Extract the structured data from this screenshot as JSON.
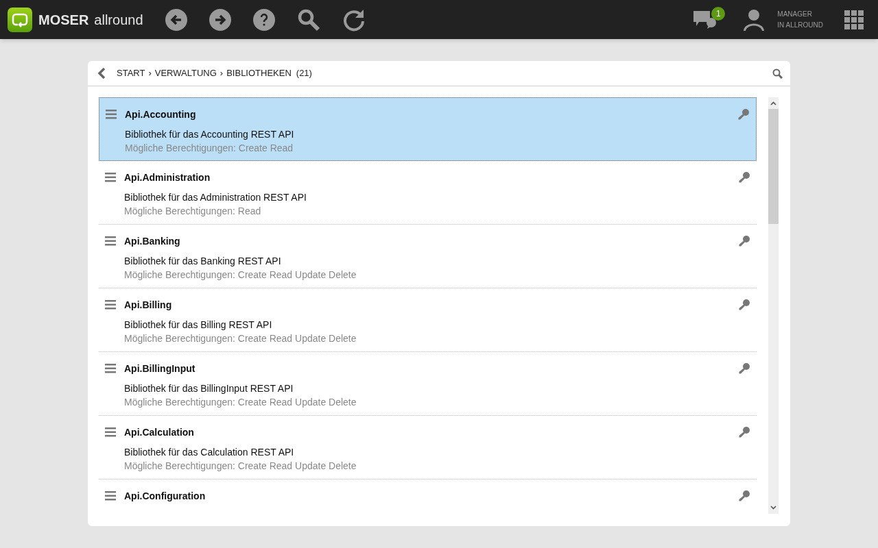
{
  "header": {
    "brand": "MOSER",
    "product": "allround",
    "messages_badge": "1",
    "user_role": "MANAGER",
    "user_scope": "IN ALLROUND"
  },
  "breadcrumb": {
    "items": [
      "START",
      "VERWALTUNG",
      "BIBLIOTHEKEN"
    ],
    "separator": "›",
    "count": "(21)"
  },
  "libraries": [
    {
      "name": "Api.Accounting",
      "description": "Bibliothek für das Accounting REST API",
      "permissions": "Mögliche Berechtigungen: Create Read",
      "selected": true
    },
    {
      "name": "Api.Administration",
      "description": "Bibliothek für das Administration REST API",
      "permissions": "Mögliche Berechtigungen: Read",
      "selected": false
    },
    {
      "name": "Api.Banking",
      "description": "Bibliothek für das Banking REST API",
      "permissions": "Mögliche Berechtigungen: Create Read Update Delete",
      "selected": false
    },
    {
      "name": "Api.Billing",
      "description": "Bibliothek für das Billing REST API",
      "permissions": "Mögliche Berechtigungen: Create Read Update Delete",
      "selected": false
    },
    {
      "name": "Api.BillingInput",
      "description": "Bibliothek für das BillingInput REST API",
      "permissions": "Mögliche Berechtigungen: Create Read Update Delete",
      "selected": false
    },
    {
      "name": "Api.Calculation",
      "description": "Bibliothek für das Calculation REST API",
      "permissions": "Mögliche Berechtigungen: Create Read Update Delete",
      "selected": false
    },
    {
      "name": "Api.Configuration",
      "selected": false
    }
  ]
}
